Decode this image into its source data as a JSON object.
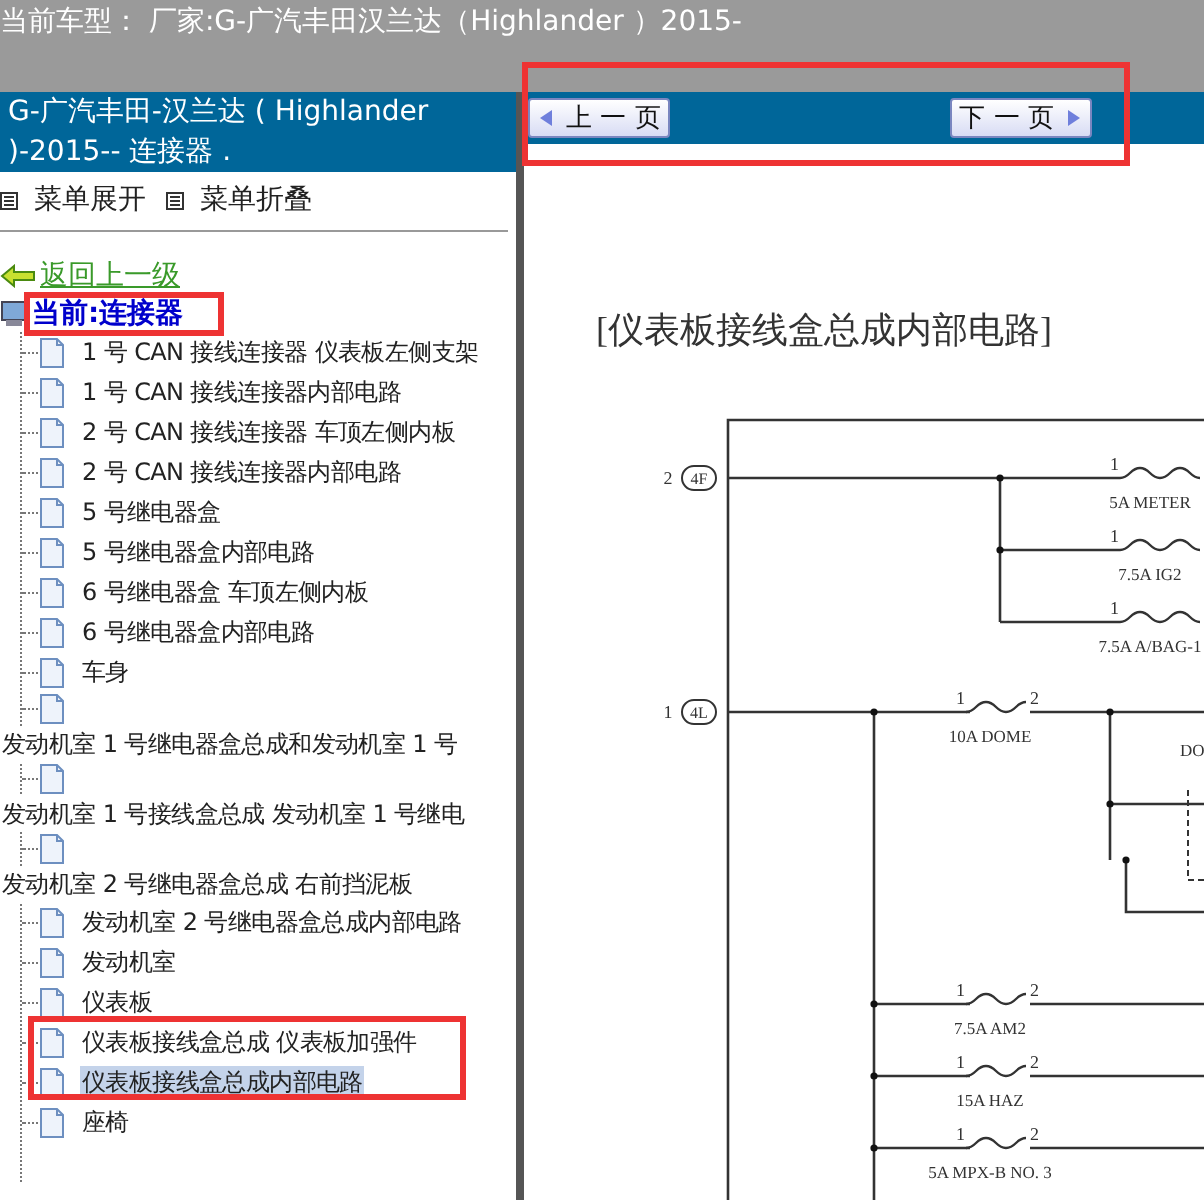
{
  "title_bar": {
    "text": "当前车型： 厂家:G-广汽丰田汉兰达（Highlander ）2015-"
  },
  "sidebar": {
    "header": "G-广汽丰田-汉兰达 ( Highlander )-2015-- 连接器 .",
    "menu_actions": [
      {
        "label": "菜单展开"
      },
      {
        "label": "菜单折叠"
      }
    ],
    "back_link": "返回上一级",
    "current": "当前:连接器",
    "items": [
      {
        "label": "1 号 CAN 接线连接器 仪表板左侧支架",
        "kind": "leaf",
        "selected": false
      },
      {
        "label": "1 号 CAN 接线连接器内部电路",
        "kind": "leaf",
        "selected": false
      },
      {
        "label": "2 号 CAN 接线连接器 车顶左侧内板",
        "kind": "leaf",
        "selected": false
      },
      {
        "label": "2 号 CAN 接线连接器内部电路",
        "kind": "leaf",
        "selected": false
      },
      {
        "label": "5 号继电器盒",
        "kind": "leaf",
        "selected": false
      },
      {
        "label": "5 号继电器盒内部电路",
        "kind": "leaf",
        "selected": false
      },
      {
        "label": "6 号继电器盒 车顶左侧内板",
        "kind": "leaf",
        "selected": false
      },
      {
        "label": "6 号继电器盒内部电路",
        "kind": "leaf",
        "selected": false
      },
      {
        "label": "车身",
        "kind": "leaf",
        "selected": false
      },
      {
        "label": "发动机室 1 号继电器盒总成和发动机室 1 号",
        "kind": "wrapped",
        "selected": false
      },
      {
        "label": "发动机室 1 号接线盒总成 发动机室 1 号继电",
        "kind": "wrapped",
        "selected": false
      },
      {
        "label": "发动机室 2 号继电器盒总成 右前挡泥板",
        "kind": "wrapped",
        "selected": false
      },
      {
        "label": "发动机室 2 号继电器盒总成内部电路",
        "kind": "leaf",
        "selected": false
      },
      {
        "label": "发动机室",
        "kind": "leaf",
        "selected": false
      },
      {
        "label": "仪表板",
        "kind": "leaf",
        "selected": false
      },
      {
        "label": "仪表板接线盒总成 仪表板加强件",
        "kind": "leaf",
        "selected": false
      },
      {
        "label": "仪表板接线盒总成内部电路",
        "kind": "leaf",
        "selected": true
      },
      {
        "label": "座椅",
        "kind": "leaf",
        "selected": false
      }
    ]
  },
  "viewer": {
    "nav_buttons": [
      {
        "label": "上 一 页",
        "kind": "prev"
      },
      {
        "label": "下 一 页",
        "kind": "next"
      }
    ],
    "document": {
      "title": "[仪表板接线盒总成内部电路]",
      "connectors": [
        {
          "pin": "2",
          "name": "4F"
        },
        {
          "pin": "1",
          "name": "4L"
        }
      ],
      "fuses": [
        {
          "label": "5A METER",
          "pin_in": "1"
        },
        {
          "label": "7.5A IG2",
          "pin_in": "1"
        },
        {
          "label": "7.5A A/BAG-1",
          "pin_in": "1"
        },
        {
          "label": "10A DOME",
          "pin_in": "1",
          "pin_out": "2"
        },
        {
          "label": "7.5A AM2",
          "pin_in": "1",
          "pin_out": "2"
        },
        {
          "label": "15A HAZ",
          "pin_in": "1",
          "pin_out": "2"
        },
        {
          "label": "5A MPX-B NO. 3",
          "pin_in": "1",
          "pin_out": "2"
        }
      ],
      "notes": [
        {
          "text": "DO"
        }
      ]
    }
  }
}
